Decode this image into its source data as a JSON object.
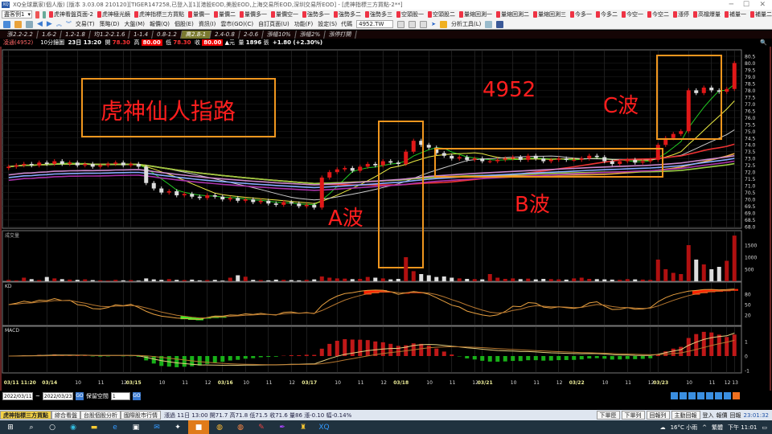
{
  "window": {
    "title": "XQ全球贏家(個人版) [版本 3.03.08 210120][TIGER147258,已登入][1][港股EOD,美股EOD,上海交易所EOD,深圳交易所EOD] - [虎神指標三方買點-2**]",
    "logo": "XQ"
  },
  "toolbar1": {
    "select": "盡客例1",
    "bookmarks": [
      "虎神看盤頁面-2",
      "虎神極光鏡",
      "虎神指標三方買點",
      "量價一",
      "量價二",
      "量價多一",
      "量價空一",
      "強勢多一",
      "強勢多二",
      "強勢多三",
      "空頭股一",
      "空頭股二",
      "量縮回測一",
      "量縮回測二",
      "量縮回測三",
      "今多一",
      "今多二",
      "今空一",
      "今空二",
      "漲停",
      "高檔爆量",
      "補量一",
      "補量二"
    ]
  },
  "toolbar2": {
    "menus": [
      "交易(T)",
      "策略(D)",
      "大盤(M)",
      "報價(Q)",
      "個股(E)",
      "資訊(I)",
      "雲市(GO)(C)",
      "自訂頁面(U)",
      "功能(F)",
      "設定(S)"
    ],
    "code_label": "代碼",
    "code_value": "4952.TW",
    "analysis_tools": "分析工具(L)"
  },
  "tabs": [
    "漲2.2-2.2",
    "1.6-2",
    "1.2-1.8",
    "均1.2-2.1.6",
    "1-1.4",
    "0.8-1.2",
    "高2.8-1",
    "2.4-0.8",
    "2-0.6",
    "漲幅10%",
    "漲幅2%",
    "漲停打開"
  ],
  "active_tab": 6,
  "info": {
    "name": "凌通(4952)",
    "period": "10分鐘圖",
    "date": "23日 13:20",
    "open_label": "開",
    "open": "78.30",
    "high_label": "高",
    "high": "80.00",
    "low_label": "低",
    "low": "78.30",
    "close_label": "收",
    "close": "80.00",
    "unit": "▲元",
    "vol_label": "量",
    "vol": "1896",
    "vol_unit": "張",
    "change": "+1.80 (+2.30%)"
  },
  "annotations": {
    "title": "虎神仙人指路",
    "code": "4952",
    "wave_a": "A波",
    "wave_b": "B波",
    "wave_c": "C波"
  },
  "panels": {
    "volume": "成交量",
    "kd": "KD",
    "macd": "MACD"
  },
  "colors": {
    "up": "#e01818",
    "down": "#dddddd",
    "box": "#f0961e",
    "annot": "#ff1e1e",
    "kd_up": "#ff2200",
    "kd_down": "#22ff22"
  },
  "chart_data": {
    "type": "candlestick",
    "symbol": "4952",
    "ylim": [
      68,
      80.5
    ],
    "yticks": [
      "80.5",
      "80.0",
      "79.5",
      "79.0",
      "78.5",
      "78.0",
      "77.5",
      "77.0",
      "76.5",
      "76.0",
      "75.5",
      "75.0",
      "74.5",
      "74.0",
      "73.5",
      "73.0",
      "72.5",
      "72.0",
      "71.5",
      "71.0",
      "70.5",
      "70.0",
      "69.5",
      "69.0",
      "68.5",
      "68.0"
    ],
    "close": [
      72.4,
      72.5,
      72.6,
      72.5,
      72.7,
      72.6,
      72.8,
      72.6,
      72.7,
      72.5,
      72.6,
      72.4,
      72.5,
      72.6,
      72.7,
      72.5,
      72.6,
      72.4,
      71.2,
      70.8,
      70.5,
      70.6,
      70.3,
      70.4,
      70.2,
      70.1,
      70.3,
      70.2,
      70.0,
      70.1,
      69.9,
      70.0,
      69.8,
      69.9,
      69.7,
      69.6,
      69.8,
      69.7,
      69.5,
      69.6,
      69.4,
      71.6,
      72.0,
      72.2,
      72.3,
      72.1,
      72.4,
      72.6,
      72.5,
      72.8,
      72.7,
      72.6,
      73.5,
      74.3,
      74.0,
      73.8,
      73.4,
      73.2,
      73.0,
      73.1,
      72.9,
      73.0,
      72.8,
      72.8,
      72.9,
      73.0,
      73.1,
      72.9,
      73.2,
      73.0,
      72.8,
      72.9,
      73.0,
      72.9,
      72.9,
      73.0,
      73.2,
      73.1,
      72.8,
      72.6,
      72.8,
      72.9,
      72.7,
      72.8,
      72.9,
      74.0,
      74.5,
      74.8,
      75.0,
      78.0,
      77.8,
      78.2,
      78.0,
      77.9,
      78.1,
      80.0
    ],
    "volume": [
      60,
      40,
      150,
      90,
      50,
      180,
      120,
      90,
      70,
      60,
      80,
      50,
      40,
      30,
      60,
      40,
      50,
      30,
      120,
      80,
      60,
      90,
      60,
      50,
      70,
      40,
      50,
      60,
      30,
      150,
      250,
      190,
      60,
      50,
      40,
      70,
      60,
      50,
      40,
      60,
      80,
      200,
      150,
      120,
      110,
      90,
      100,
      180,
      150,
      120,
      80,
      100,
      1000,
      420,
      300,
      250,
      180,
      200,
      150,
      120,
      100,
      90,
      80,
      300,
      150,
      100,
      120,
      90,
      110,
      80,
      100,
      90,
      80,
      70,
      120,
      150,
      100,
      90,
      80,
      70,
      60,
      90,
      80,
      70,
      60,
      900,
      500,
      350,
      300,
      1500,
      900,
      700,
      500,
      600,
      850,
      1896
    ],
    "volume_yticks": [
      "1500",
      "1000",
      "500"
    ],
    "kd_yticks": [
      "80",
      "50",
      "20"
    ],
    "macd_yticks": [
      "1",
      "0",
      "-1"
    ],
    "xticks": [
      {
        "i": 0,
        "label": "03/11 11:20"
      },
      {
        "i": 5,
        "label": "03/14"
      },
      {
        "i": 9,
        "label": "10"
      },
      {
        "i": 12,
        "label": "11"
      },
      {
        "i": 15,
        "label": "12"
      },
      {
        "i": 16,
        "label": "03/15"
      },
      {
        "i": 20,
        "label": "10"
      },
      {
        "i": 23,
        "label": "11"
      },
      {
        "i": 26,
        "label": "12"
      },
      {
        "i": 28,
        "label": "03/16"
      },
      {
        "i": 31,
        "label": "10"
      },
      {
        "i": 34,
        "label": "11"
      },
      {
        "i": 37,
        "label": "12"
      },
      {
        "i": 39,
        "label": "03/17"
      },
      {
        "i": 43,
        "label": "10"
      },
      {
        "i": 46,
        "label": "11"
      },
      {
        "i": 49,
        "label": "12"
      },
      {
        "i": 51,
        "label": "03/18"
      },
      {
        "i": 55,
        "label": "10"
      },
      {
        "i": 58,
        "label": "11"
      },
      {
        "i": 61,
        "label": "12"
      },
      {
        "i": 62,
        "label": "03/21"
      },
      {
        "i": 66,
        "label": "10"
      },
      {
        "i": 69,
        "label": "11"
      },
      {
        "i": 72,
        "label": "12"
      },
      {
        "i": 74,
        "label": "03/22"
      },
      {
        "i": 78,
        "label": "10"
      },
      {
        "i": 81,
        "label": "11"
      },
      {
        "i": 84,
        "label": "12"
      },
      {
        "i": 85,
        "label": "03/23"
      },
      {
        "i": 89,
        "label": "10"
      },
      {
        "i": 92,
        "label": "11"
      },
      {
        "i": 94,
        "label": "12"
      },
      {
        "i": 95,
        "label": "13"
      }
    ]
  },
  "datebar": {
    "from": "2022/03/11",
    "to": "2022/03/23",
    "sep": "~",
    "reserve_label": "保留空間",
    "reserve_value": "1",
    "go": "GO"
  },
  "statusbar": {
    "tabs": [
      "虎神指標三方買點",
      "綜合看盤",
      "台股個股分析",
      "國際股市行情"
    ],
    "quote": "漲過 11日 13:00 開71.7 高71.8 低71.5 收71.6 量86 漲-0.10 幅-0.14%",
    "buttons": [
      "下單匣",
      "下單列",
      "回報列",
      "主動回報"
    ],
    "login": "登入",
    "report": "報價",
    "reply": "回報",
    "clock": "23:01:32"
  },
  "taskbar": {
    "weather": "16°C 小雨",
    "lang": "繁體",
    "time": "下午 11:01"
  }
}
